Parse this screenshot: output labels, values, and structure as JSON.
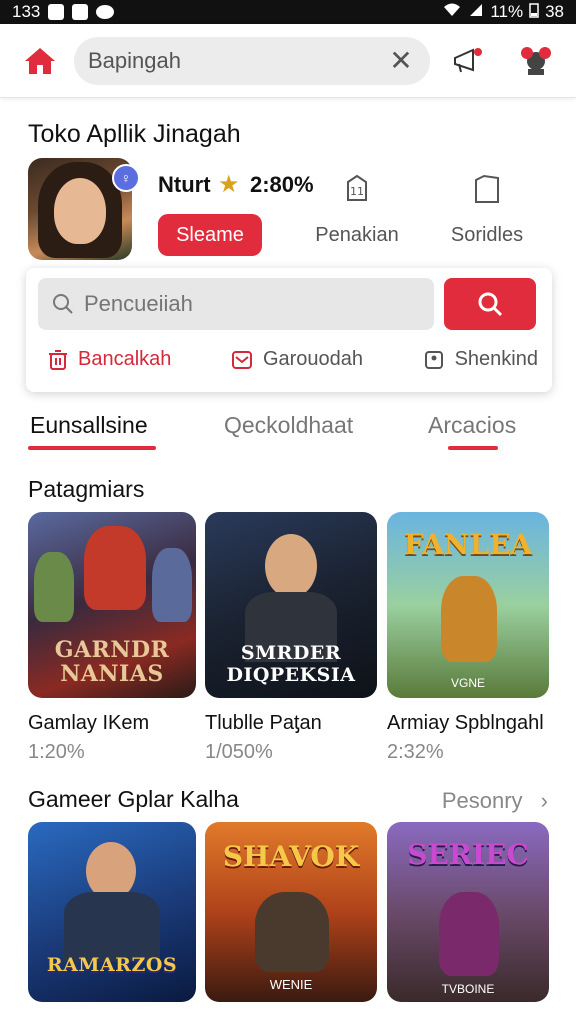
{
  "status_bar": {
    "time": "133",
    "battery": "11%",
    "signal_text": "38"
  },
  "top_bar": {
    "search_value": "Bapingah"
  },
  "section_title": "Toko Apllik Jinagah",
  "featured": {
    "name": "Nturt",
    "rating": "2:80%",
    "primary_button": "Sleame",
    "actions": [
      {
        "label": "Penakian",
        "icon": "badge-icon"
      },
      {
        "label": "Soridles",
        "icon": "bookmark-icon"
      }
    ]
  },
  "search_card": {
    "placeholder": "Pencueiiah",
    "filters": [
      {
        "label": "Bancalkah",
        "icon": "trash-icon",
        "active": true
      },
      {
        "label": "Garouodah",
        "icon": "mail-icon",
        "active": false
      },
      {
        "label": "Shenkind",
        "icon": "square-dot-icon",
        "active": false
      }
    ]
  },
  "tabs": [
    {
      "label": "Eunsallsine",
      "active": true
    },
    {
      "label": "Qeckoldhaat",
      "active": false
    },
    {
      "label": "Arcacios",
      "active": false
    }
  ],
  "section_one": {
    "title": "Patagmiars",
    "cards": [
      {
        "name": "Gamlay IKem",
        "stat": "1:20%",
        "logo": "GARNDR NANIAS",
        "subtitle": ""
      },
      {
        "name": "Tlublle Paƫan",
        "stat": "1/050%",
        "logo": "SMRDER DIQPEKSIA",
        "subtitle": ""
      },
      {
        "name": "Armiay Spblngahl",
        "stat": "2:32%",
        "logo": "FANLEA",
        "subtitle": "VGNE"
      }
    ]
  },
  "section_two": {
    "title": "Gameer Gplar Kalha",
    "see_more": "Pesonry",
    "cards": [
      {
        "logo": "RAMARZOS",
        "subtitle": ""
      },
      {
        "logo": "SHAVOK",
        "subtitle": "WENIE"
      },
      {
        "logo": "SERIEC",
        "subtitle": "TVBOINE"
      }
    ]
  },
  "colors": {
    "accent": "#e02c3c",
    "text": "#111111",
    "muted": "#777777"
  }
}
